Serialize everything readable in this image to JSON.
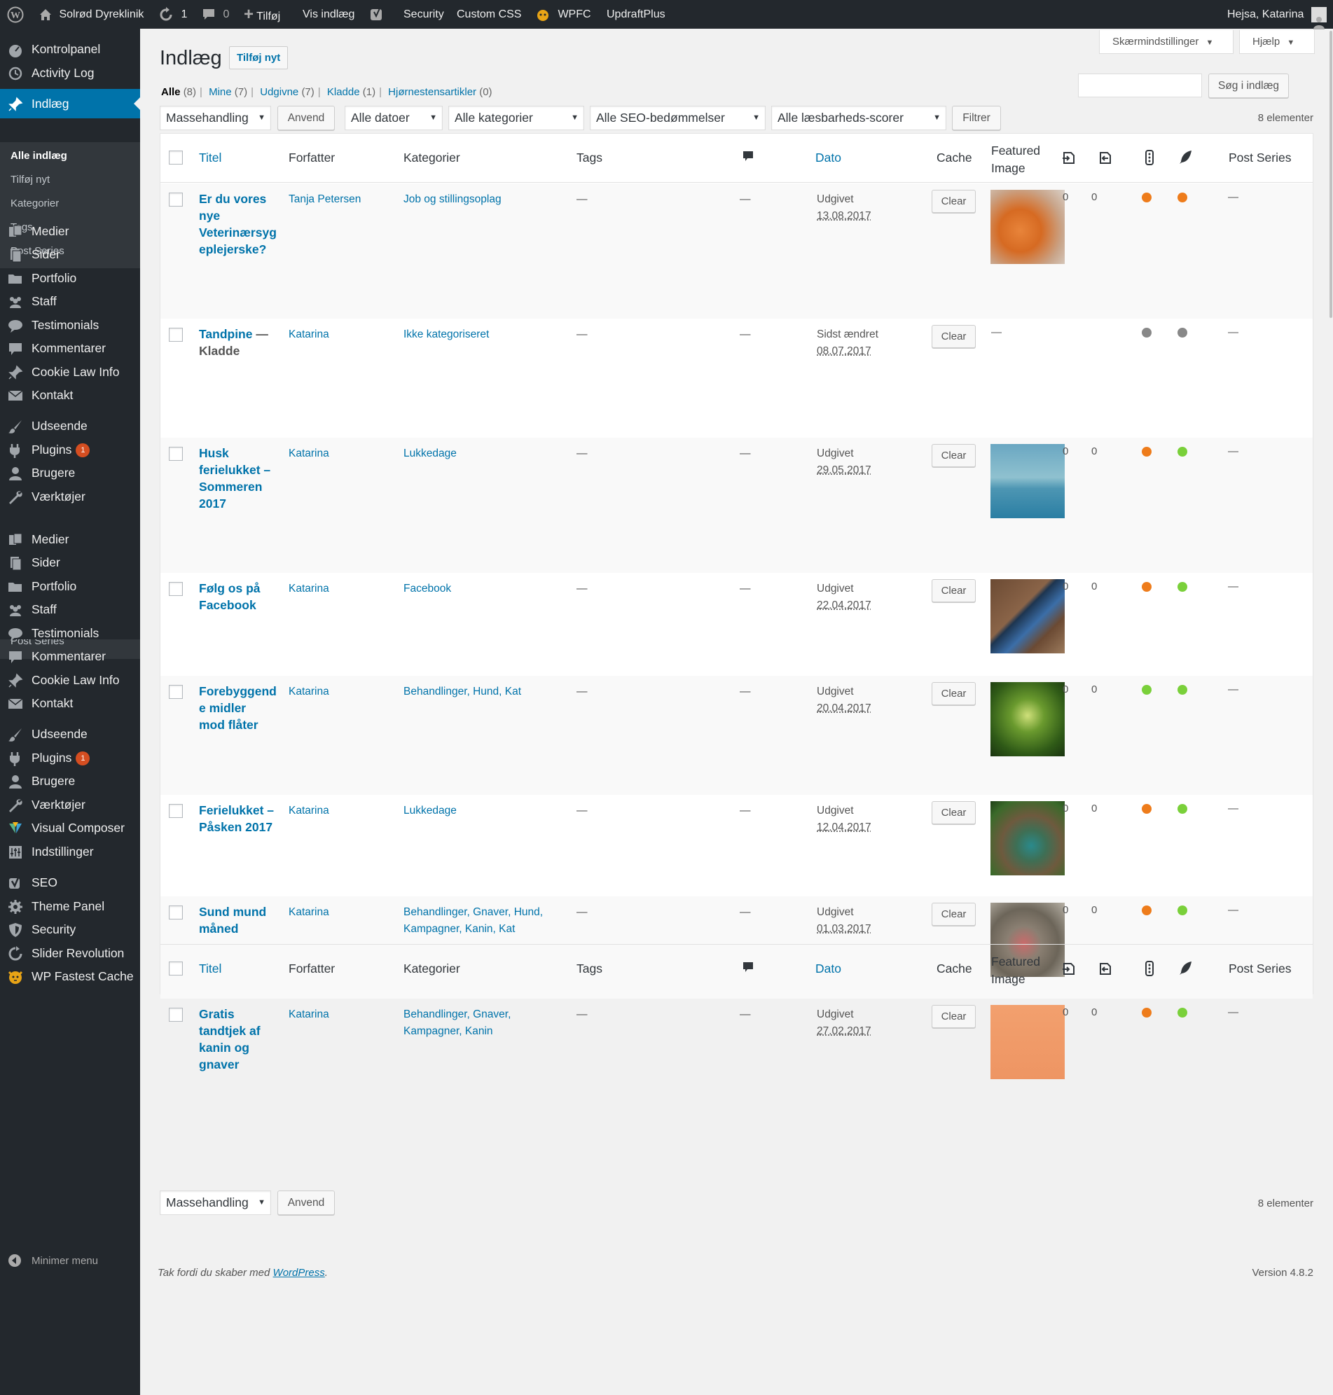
{
  "adminbar": {
    "site_name": "Solrød Dyreklinik",
    "updates_count": "1",
    "comments_count": "0",
    "add_new": "Tilføj",
    "view_posts": "Vis indlæg",
    "security": "Security",
    "custom_css": "Custom CSS",
    "wpfc": "WPFC",
    "updraft": "UpdraftPlus",
    "greeting": "Hejsa, Katarina"
  },
  "sidebar": {
    "items": [
      {
        "label": "Kontrolpanel",
        "icon": "dashboard-icon"
      },
      {
        "label": "Activity Log",
        "icon": "history-icon"
      },
      {
        "label": "Indlæg",
        "icon": "pin-icon"
      },
      {
        "label": "Medier",
        "icon": "media-icon"
      },
      {
        "label": "Sider",
        "icon": "page-icon"
      },
      {
        "label": "Portfolio",
        "icon": "folder-icon"
      },
      {
        "label": "Staff",
        "icon": "groups-icon"
      },
      {
        "label": "Testimonials",
        "icon": "speech-bubble-icon"
      },
      {
        "label": "Kommentarer",
        "icon": "comment-icon"
      },
      {
        "label": "Cookie Law Info",
        "icon": "pin-icon"
      },
      {
        "label": "Kontakt",
        "icon": "mail-icon"
      },
      {
        "label": "Udseende",
        "icon": "brush-icon"
      },
      {
        "label": "Plugins",
        "icon": "plugin-icon",
        "badge": "1"
      },
      {
        "label": "Brugere",
        "icon": "user-icon"
      },
      {
        "label": "Værktøjer",
        "icon": "wrench-icon"
      },
      {
        "label": "Medier",
        "icon": "media-icon"
      },
      {
        "label": "Sider",
        "icon": "page-icon"
      },
      {
        "label": "Portfolio",
        "icon": "folder-icon"
      },
      {
        "label": "Staff",
        "icon": "groups-icon"
      },
      {
        "label": "Testimonials",
        "icon": "speech-bubble-icon"
      },
      {
        "label": "Kommentarer",
        "icon": "comment-icon"
      },
      {
        "label": "Cookie Law Info",
        "icon": "pin-icon"
      },
      {
        "label": "Kontakt",
        "icon": "mail-icon"
      },
      {
        "label": "Udseende",
        "icon": "brush-icon"
      },
      {
        "label": "Plugins",
        "icon": "plugin-icon",
        "badge": "1"
      },
      {
        "label": "Brugere",
        "icon": "user-icon"
      },
      {
        "label": "Værktøjer",
        "icon": "wrench-icon"
      },
      {
        "label": "Visual Composer",
        "icon": "visual-composer-icon"
      },
      {
        "label": "Indstillinger",
        "icon": "settings-icon"
      },
      {
        "label": "SEO",
        "icon": "yoast-icon"
      },
      {
        "label": "Theme Panel",
        "icon": "gear-icon"
      },
      {
        "label": "Security",
        "icon": "shield-icon"
      },
      {
        "label": "Slider Revolution",
        "icon": "refresh-icon"
      },
      {
        "label": "WP Fastest Cache",
        "icon": "cheetah-icon"
      }
    ],
    "submenu": [
      "Alle indlæg",
      "Tilføj nyt",
      "Kategorier",
      "Tags",
      "Post Series"
    ],
    "cut_label": "Post Series",
    "minimize": "Minimer menu"
  },
  "screen_options": "Skærmindstillinger",
  "help": "Hjælp",
  "page_title": "Indlæg",
  "add_new_button": "Tilføj nyt",
  "views": [
    {
      "label": "Alle",
      "count": "(8)"
    },
    {
      "label": "Mine",
      "count": "(7)"
    },
    {
      "label": "Udgivne",
      "count": "(7)"
    },
    {
      "label": "Kladde",
      "count": "(1)"
    },
    {
      "label": "Hjørnestensartikler",
      "count": "(0)"
    }
  ],
  "search_button": "Søg i indlæg",
  "filters": {
    "bulk": "Massehandling",
    "apply": "Anvend",
    "dates": "Alle datoer",
    "categories": "Alle kategorier",
    "seo": "Alle SEO-bedømmelser",
    "readability": "Alle læsbarheds-scorer",
    "filter": "Filtrer",
    "count": "8 elementer"
  },
  "columns": {
    "title": "Titel",
    "author": "Forfatter",
    "categories": "Kategorier",
    "tags": "Tags",
    "date": "Dato",
    "cache": "Cache",
    "featured1": "Featured",
    "featured2": "Image",
    "series": "Post Series"
  },
  "colors": {
    "orange": "#ee7c1b",
    "green": "#7ad03a",
    "gray": "#888888",
    "accent": "#0073aa"
  },
  "posts": [
    {
      "title": [
        "Er du vores",
        "nye",
        "Veterinærsyg",
        "eplejerske?"
      ],
      "status": "",
      "author": "Tanja Petersen",
      "categories": [
        "Job og stillingsoplag"
      ],
      "tags": "—",
      "comments": "—",
      "date_label": "Udgivet",
      "date": "13.08.2017",
      "clear": "Clear",
      "has_image": true,
      "links_in": "0",
      "links_out": "0",
      "seo": "orange",
      "read": "orange",
      "series": "—"
    },
    {
      "title": [
        "Tandpine"
      ],
      "status": "— Kladde",
      "author": "Katarina",
      "categories": [
        "Ikke kategoriseret"
      ],
      "tags": "—",
      "comments": "—",
      "date_label": "Sidst ændret",
      "date": "08.07.2017",
      "clear": "Clear",
      "has_image": false,
      "no_image": "—",
      "links_in": "",
      "links_out": "",
      "seo": "gray",
      "read": "gray",
      "series": "—"
    },
    {
      "title": [
        "Husk",
        "ferielukket –",
        "Sommeren",
        "2017"
      ],
      "status": "",
      "author": "Katarina",
      "categories": [
        "Lukkedage"
      ],
      "tags": "—",
      "comments": "—",
      "date_label": "Udgivet",
      "date": "29.05.2017",
      "clear": "Clear",
      "has_image": true,
      "links_in": "0",
      "links_out": "0",
      "seo": "orange",
      "read": "green",
      "series": "—"
    },
    {
      "title": [
        "Følg os på",
        "Facebook"
      ],
      "status": "",
      "author": "Katarina",
      "categories": [
        "Facebook"
      ],
      "tags": "—",
      "comments": "—",
      "date_label": "Udgivet",
      "date": "22.04.2017",
      "clear": "Clear",
      "has_image": true,
      "links_in": "0",
      "links_out": "0",
      "seo": "orange",
      "read": "green",
      "series": "—"
    },
    {
      "title": [
        "Forebyggend",
        "e midler",
        "mod flåter"
      ],
      "status": "",
      "author": "Katarina",
      "categories": [
        "Behandlinger, Hund, Kat"
      ],
      "tags": "—",
      "comments": "—",
      "date_label": "Udgivet",
      "date": "20.04.2017",
      "clear": "Clear",
      "has_image": true,
      "links_in": "0",
      "links_out": "0",
      "seo": "green",
      "read": "green",
      "series": "—"
    },
    {
      "title": [
        "Ferielukket –",
        "Påsken 2017"
      ],
      "status": "",
      "author": "Katarina",
      "categories": [
        "Lukkedage"
      ],
      "tags": "—",
      "comments": "—",
      "date_label": "Udgivet",
      "date": "12.04.2017",
      "clear": "Clear",
      "has_image": true,
      "links_in": "0",
      "links_out": "0",
      "seo": "orange",
      "read": "green",
      "series": "—"
    },
    {
      "title": [
        "Sund mund",
        "måned"
      ],
      "status": "",
      "author": "Katarina",
      "categories": [
        "Behandlinger, Gnaver, Hund,",
        "Kampagner, Kanin, Kat"
      ],
      "tags": "—",
      "comments": "—",
      "date_label": "Udgivet",
      "date": "01.03.2017",
      "clear": "Clear",
      "has_image": true,
      "links_in": "0",
      "links_out": "0",
      "seo": "orange",
      "read": "green",
      "series": "—"
    },
    {
      "title": [
        "Gratis",
        "tandtjek af",
        "kanin og",
        "gnaver"
      ],
      "status": "",
      "author": "Katarina",
      "categories": [
        "Behandlinger, Gnaver,",
        "Kampagner, Kanin"
      ],
      "tags": "—",
      "comments": "—",
      "date_label": "Udgivet",
      "date": "27.02.2017",
      "clear": "Clear",
      "has_image": true,
      "links_in": "0",
      "links_out": "0",
      "seo": "orange",
      "read": "green",
      "series": "—"
    }
  ],
  "footer": {
    "thanks": "Tak fordi du skaber med",
    "wp": "WordPress",
    "version": "Version 4.8.2"
  }
}
